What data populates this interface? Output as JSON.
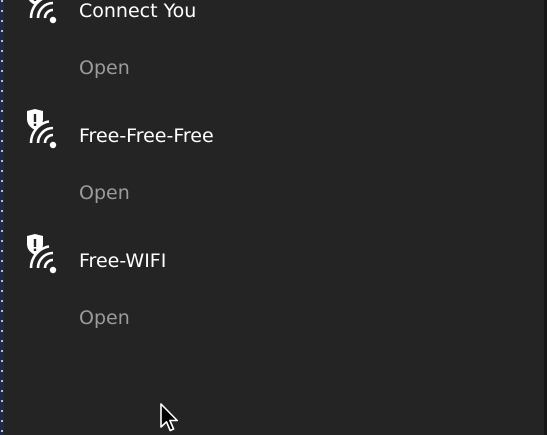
{
  "networks": [
    {
      "name": "Connect You",
      "security": "Open",
      "icon": "wifi-shield-warning-icon"
    },
    {
      "name": "Free-Free-Free",
      "security": "Open",
      "icon": "wifi-shield-warning-icon"
    },
    {
      "name": "Free-WIFI",
      "security": "Open",
      "icon": "wifi-shield-warning-icon"
    }
  ],
  "colors": {
    "background": "#242424",
    "primary_text": "#ffffff",
    "secondary_text": "#9b9b9b"
  }
}
